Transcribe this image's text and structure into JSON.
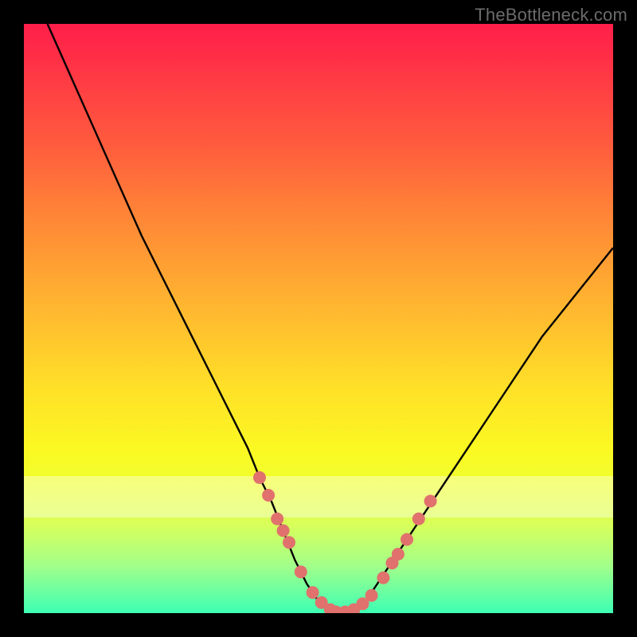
{
  "attribution": "TheBottleneck.com",
  "chart_data": {
    "type": "line",
    "title": "",
    "xlabel": "",
    "ylabel": "",
    "xlim": [
      0,
      100
    ],
    "ylim": [
      0,
      100
    ],
    "series": [
      {
        "name": "curve",
        "x": [
          4,
          8,
          12,
          16,
          20,
          24,
          28,
          32,
          36,
          38,
          40,
          42,
          44,
          46,
          48,
          50,
          52,
          54,
          56,
          58,
          60,
          64,
          68,
          72,
          76,
          80,
          84,
          88,
          92,
          96,
          100
        ],
        "y": [
          100,
          91,
          82,
          73,
          64,
          56,
          48,
          40,
          32,
          28,
          23,
          19,
          14,
          9,
          5,
          2,
          0.5,
          0,
          0.5,
          2,
          5,
          11,
          17,
          23,
          29,
          35,
          41,
          47,
          52,
          57,
          62
        ]
      }
    ],
    "markers": {
      "name": "dots",
      "x": [
        40,
        41.5,
        43,
        44,
        45,
        47,
        49,
        50.5,
        52,
        53,
        54.5,
        56,
        57.5,
        59,
        61,
        62.5,
        63.5,
        65,
        67,
        69
      ],
      "y": [
        23,
        20,
        16,
        14,
        12,
        7,
        3.5,
        1.8,
        0.6,
        0.2,
        0.2,
        0.6,
        1.6,
        3,
        6,
        8.5,
        10,
        12.5,
        16,
        19
      ]
    },
    "colors": {
      "curve": "#000000",
      "markers": "#e0716d"
    }
  }
}
